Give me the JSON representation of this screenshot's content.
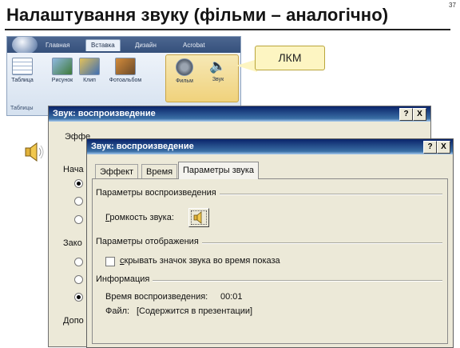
{
  "slide": {
    "title": "Налаштування звуку (фільми – аналогічно)",
    "page_number": "37"
  },
  "ribbon": {
    "tabs": [
      "Главная",
      "Вставка",
      "Дизайн",
      "Acrobat"
    ],
    "buttons": [
      "Таблица",
      "Рисунок",
      "Клип",
      "Фотоальбом",
      "Фильм",
      "Звук"
    ],
    "group_label": "Таблицы"
  },
  "callout": {
    "text": "ЛКМ"
  },
  "back_dialog": {
    "title": "Звук: воспроизведение",
    "help": "?",
    "close": "X",
    "tab_partial": "Эффе",
    "section_start": "Нача",
    "section_after": "Зако",
    "section_extra": "Допо"
  },
  "front_dialog": {
    "title": "Звук: воспроизведение",
    "help": "?",
    "close": "X",
    "tabs": [
      "Эффект",
      "Время",
      "Параметры звука"
    ],
    "playback_section": "Параметры воспроизведения",
    "volume_prefix": "Г",
    "volume_rest": "ромкость звука:",
    "display_section": "Параметры отображения",
    "hide_prefix": "с",
    "hide_rest": "крывать значок звука во время показа",
    "hide_checked": false,
    "info_section": "Информация",
    "duration_label": "Время воспроизведения:",
    "duration_value": "00:01",
    "file_label": "Файл:",
    "file_value": "[Содержится в презентации]"
  }
}
